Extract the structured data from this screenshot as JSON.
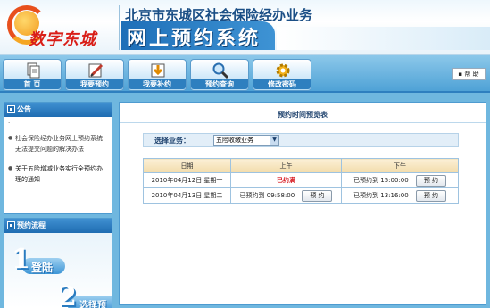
{
  "header": {
    "logo_text": "数字东城",
    "org_title": "北京市东城区社会保险经办业务",
    "system_title": "网上预约系统"
  },
  "nav": {
    "items": [
      {
        "label": "首  页",
        "icon": "document-icon"
      },
      {
        "label": "我要预约",
        "icon": "edit-icon"
      },
      {
        "label": "我要补约",
        "icon": "download-arrow-icon"
      },
      {
        "label": "预约查询",
        "icon": "magnifier-icon"
      },
      {
        "label": "修改密码",
        "icon": "gear-icon"
      }
    ],
    "help_label": "帮 助"
  },
  "sidebar": {
    "notice": {
      "title": "公告",
      "dot": "·",
      "items": [
        "社会保险经办业务网上预约系统无法提交问题的解决办法",
        "关于五险增减业务实行全预约办理的通知"
      ]
    },
    "flow": {
      "title": "预约流程",
      "steps": [
        {
          "num": "1",
          "label": "登陆"
        },
        {
          "num": "2",
          "label": "选择预"
        }
      ]
    }
  },
  "main": {
    "title": "预约时间预览表",
    "business_label": "选择业务：",
    "business_value": "五险收缴业务",
    "table": {
      "headers": [
        "日期",
        "上午",
        "下午"
      ],
      "rows": [
        {
          "date": "2010年04月12日 星期一",
          "am": "已约满",
          "am_button": "",
          "pm": "已预约到 15:00:00",
          "pm_button": "预 约"
        },
        {
          "date": "2010年04月13日 星期二",
          "am": "已预约到 09:58:00",
          "am_button": "预 约",
          "pm": "已预约到 13:16:00",
          "pm_button": "预 约"
        }
      ]
    }
  },
  "colors": {
    "background": "#6fb7df",
    "brand_blue": "#1e6fb8",
    "full_red": "#d6141b"
  }
}
